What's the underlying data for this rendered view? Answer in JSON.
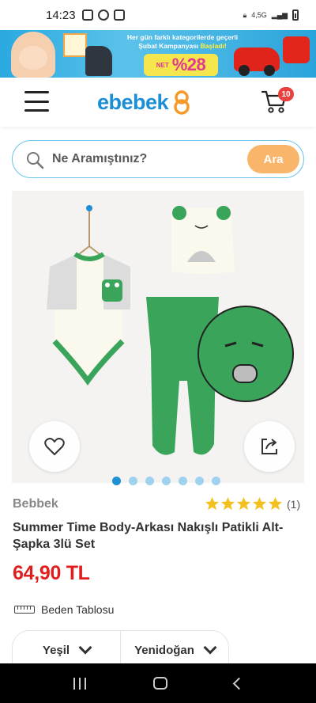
{
  "status_bar": {
    "time": "14:23",
    "network": "4,5G"
  },
  "promo": {
    "line1": "Her gün farklı kategorilerde geçerli",
    "line2_prefix": "Şubat Kampanyası",
    "line2_highlight": "Başladı!",
    "badge_prefix": "NET",
    "badge_value": "%28"
  },
  "header": {
    "logo_text": "ebebek",
    "cart_count": "10"
  },
  "search": {
    "placeholder": "Ne Aramıştınız?",
    "button_label": "Ara"
  },
  "gallery": {
    "dot_count": 7,
    "active_index": 0
  },
  "product": {
    "brand": "Bebbek",
    "rating_stars": 5,
    "rating_count": "(1)",
    "title": "Summer Time Body-Arkası Nakışlı Patikli Alt-Şapka 3lü Set",
    "price": "64,90 TL",
    "size_chart_label": "Beden Tablosu"
  },
  "variants": {
    "color": "Yeşil",
    "size": "Yenidoğan"
  },
  "colors": {
    "brand_blue": "#1a8fd6",
    "search_button": "#f9b66b",
    "price_red": "#e01e1e",
    "star": "#f4c01e",
    "cart_badge": "#e8413e",
    "garment_green": "#3aa55a"
  }
}
